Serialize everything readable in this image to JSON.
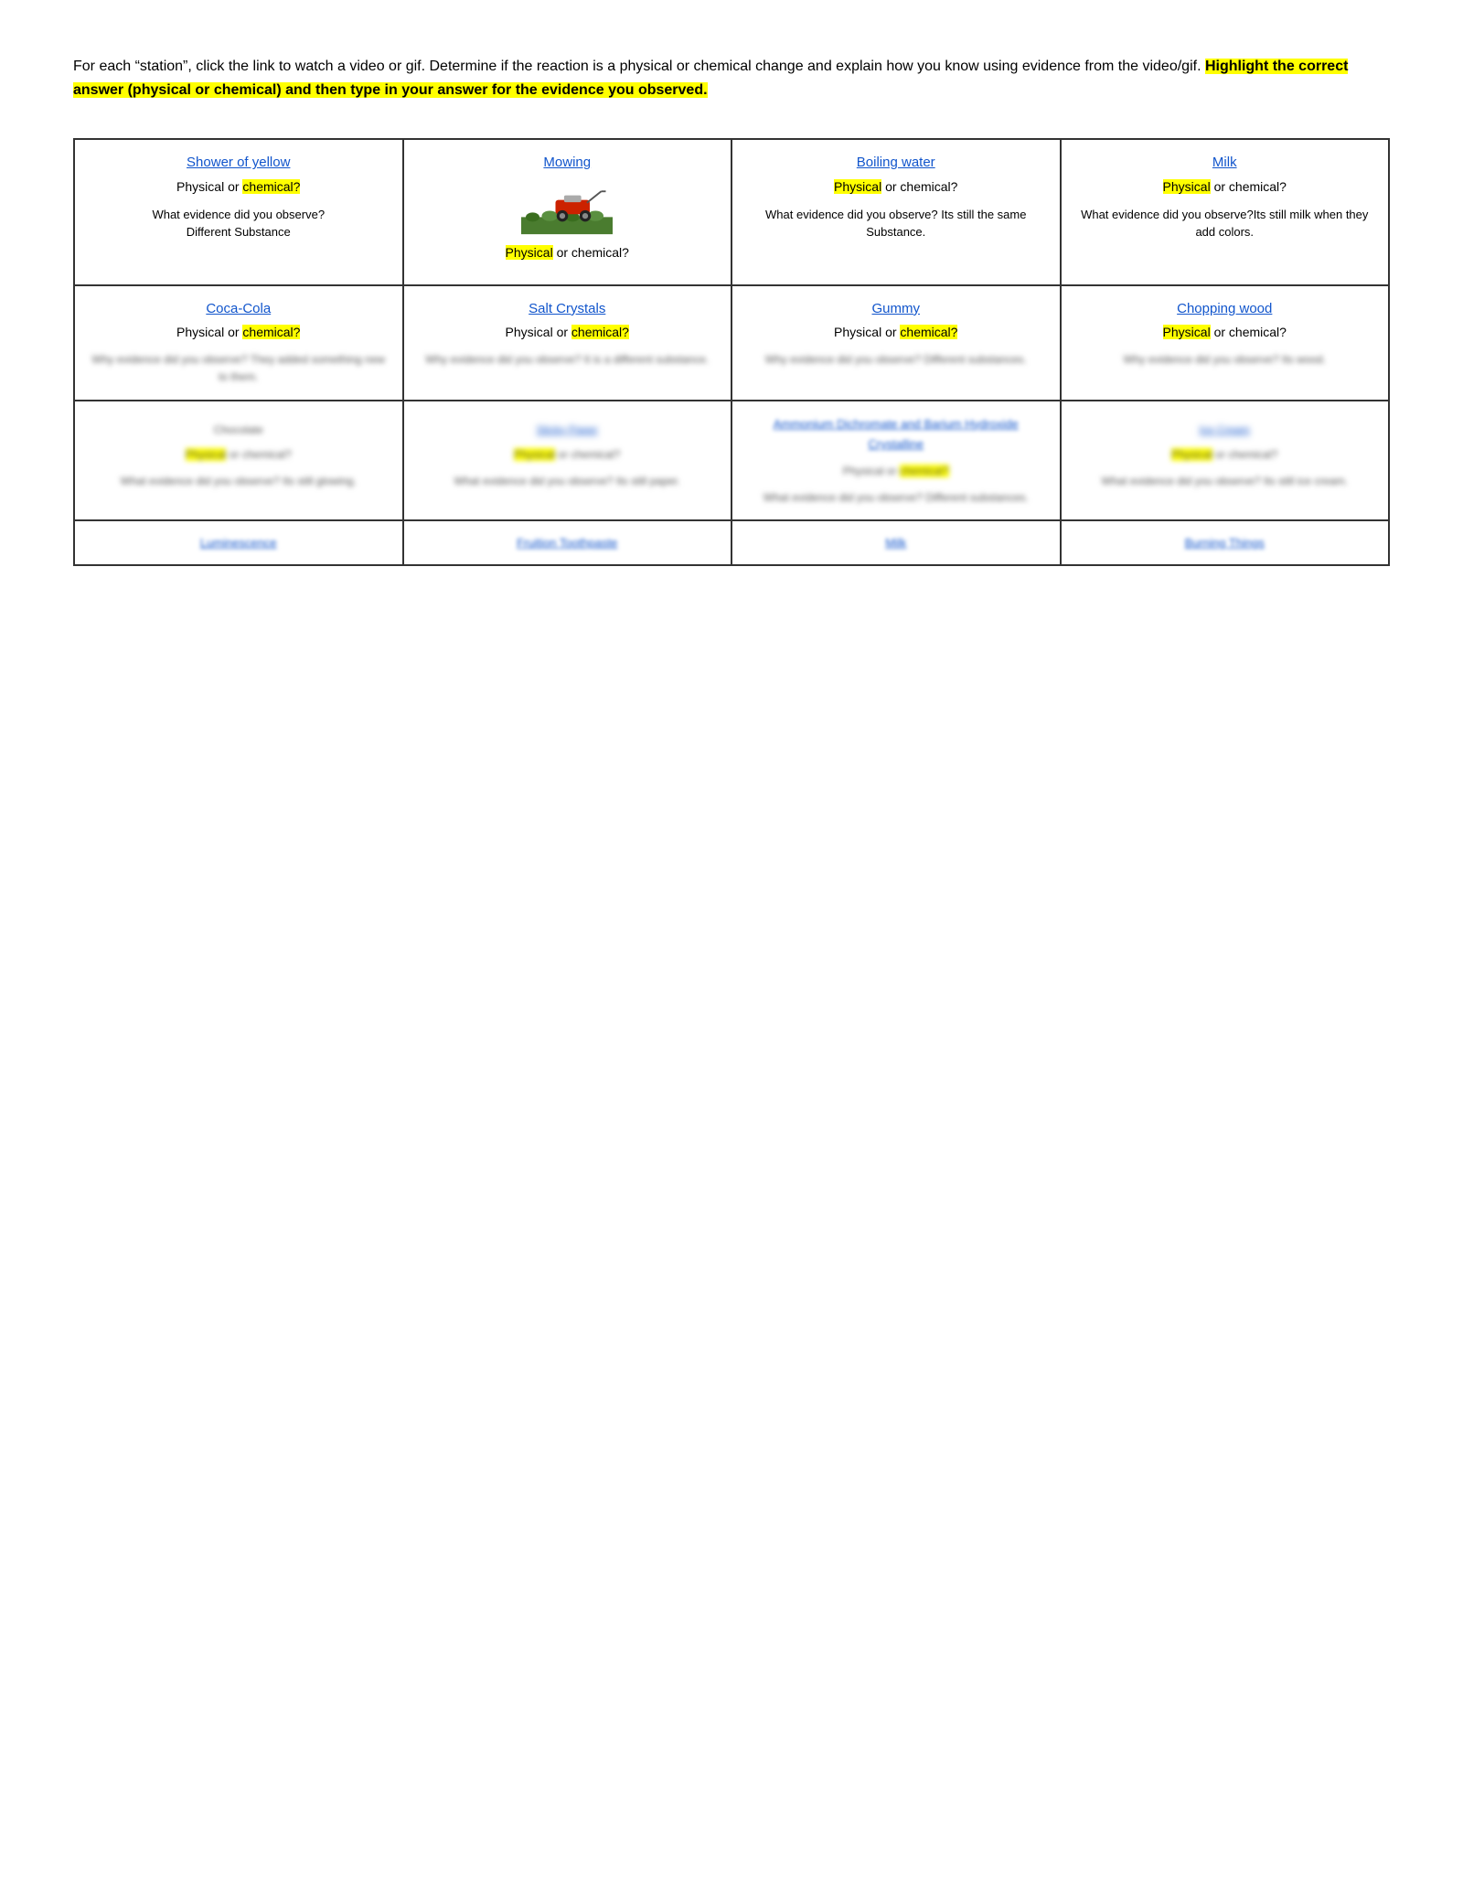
{
  "intro": {
    "text1": "For each “station”, click the link to watch a video or gif.  Determine if the reaction is a physical or chemical change and explain how you know using evidence from the video/gif.  ",
    "highlighted": "Highlight the correct answer (physical or chemical) and then type in your answer for the evidence you observed."
  },
  "table": {
    "rows": [
      {
        "cells": [
          {
            "title": "Shower of yellow",
            "title_link": true,
            "question": "Physical or chemical?",
            "chemical_highlighted": true,
            "evidence_label": "What evidence did you observe?",
            "evidence_text": "Different Substance",
            "blurred": false
          },
          {
            "title": "Mowing",
            "title_link": true,
            "question": "Physical or chemical?",
            "physical_highlighted": true,
            "has_image": true,
            "blurred": false
          },
          {
            "title": "Boiling water",
            "title_link": true,
            "question": "Physical or chemical?",
            "physical_highlighted": true,
            "evidence_label": "What evidence did you observe?",
            "evidence_text": "Its still the same Substance.",
            "blurred": false
          },
          {
            "title": "Milk",
            "title_link": true,
            "question": "Physical or chemical?",
            "physical_highlighted": true,
            "evidence_label": "What evidence did you observe?",
            "evidence_text": "Its still milk when they add colors.",
            "blurred": false
          }
        ]
      },
      {
        "cells": [
          {
            "title": "Coca-Cola",
            "title_link": true,
            "question": "Physical or chemical?",
            "chemical_highlighted": true,
            "evidence_blurred": "Why evidence did you observe? They added something new to them.",
            "blurred": true
          },
          {
            "title": "Salt Crystals",
            "title_link": true,
            "question": "Physical or chemical?",
            "chemical_highlighted": true,
            "evidence_blurred": "Why evidence did you observe? It is a different substance.",
            "blurred": true
          },
          {
            "title": "Gummy",
            "title_link": true,
            "question": "Physical or chemical?",
            "chemical_highlighted": true,
            "evidence_blurred": "Why evidence did you observe? Different substances.",
            "blurred": true
          },
          {
            "title": "Chopping wood",
            "title_link": true,
            "question": "Physical or chemical?",
            "physical_highlighted": true,
            "evidence_blurred": "Why evidence did you observe? Its wood.",
            "blurred": true
          }
        ]
      },
      {
        "cells": [
          {
            "title": "Chocolate",
            "title_link": false,
            "question": "Physical or chemical?",
            "physical_highlighted": true,
            "evidence_blurred": "What evidence did you observe? Its still glowing.",
            "blurred": true
          },
          {
            "title": "Sticky Paper",
            "title_link": true,
            "question": "Physical or chemical?",
            "physical_highlighted": true,
            "evidence_blurred": "What evidence did you observe? Its still paper.",
            "blurred": true
          },
          {
            "title": "Ammonium Dichromate and Barium Hydroxide Crystalline",
            "title_link": true,
            "question": "Physical or chemical?",
            "chemical_highlighted": true,
            "evidence_blurred": "What evidence did you observe? Different substances.",
            "blurred": true,
            "multiline_title": true
          },
          {
            "title": "Ice Cream",
            "title_link": true,
            "question": "Physical or chemical?",
            "physical_highlighted": true,
            "evidence_blurred": "What evidence did you observe? Its still ice cream.",
            "blurred": true
          }
        ]
      },
      {
        "cells": [
          {
            "title": "Luminescence",
            "title_link": true,
            "bottom_row": true,
            "blurred": true
          },
          {
            "title": "Fruition Toothpaste",
            "title_link": true,
            "bottom_row": true,
            "blurred": true
          },
          {
            "title": "Milk",
            "title_link": true,
            "bottom_row": true,
            "blurred": true
          },
          {
            "title": "Burning Things",
            "title_link": true,
            "bottom_row": true,
            "blurred": true
          }
        ]
      }
    ]
  }
}
